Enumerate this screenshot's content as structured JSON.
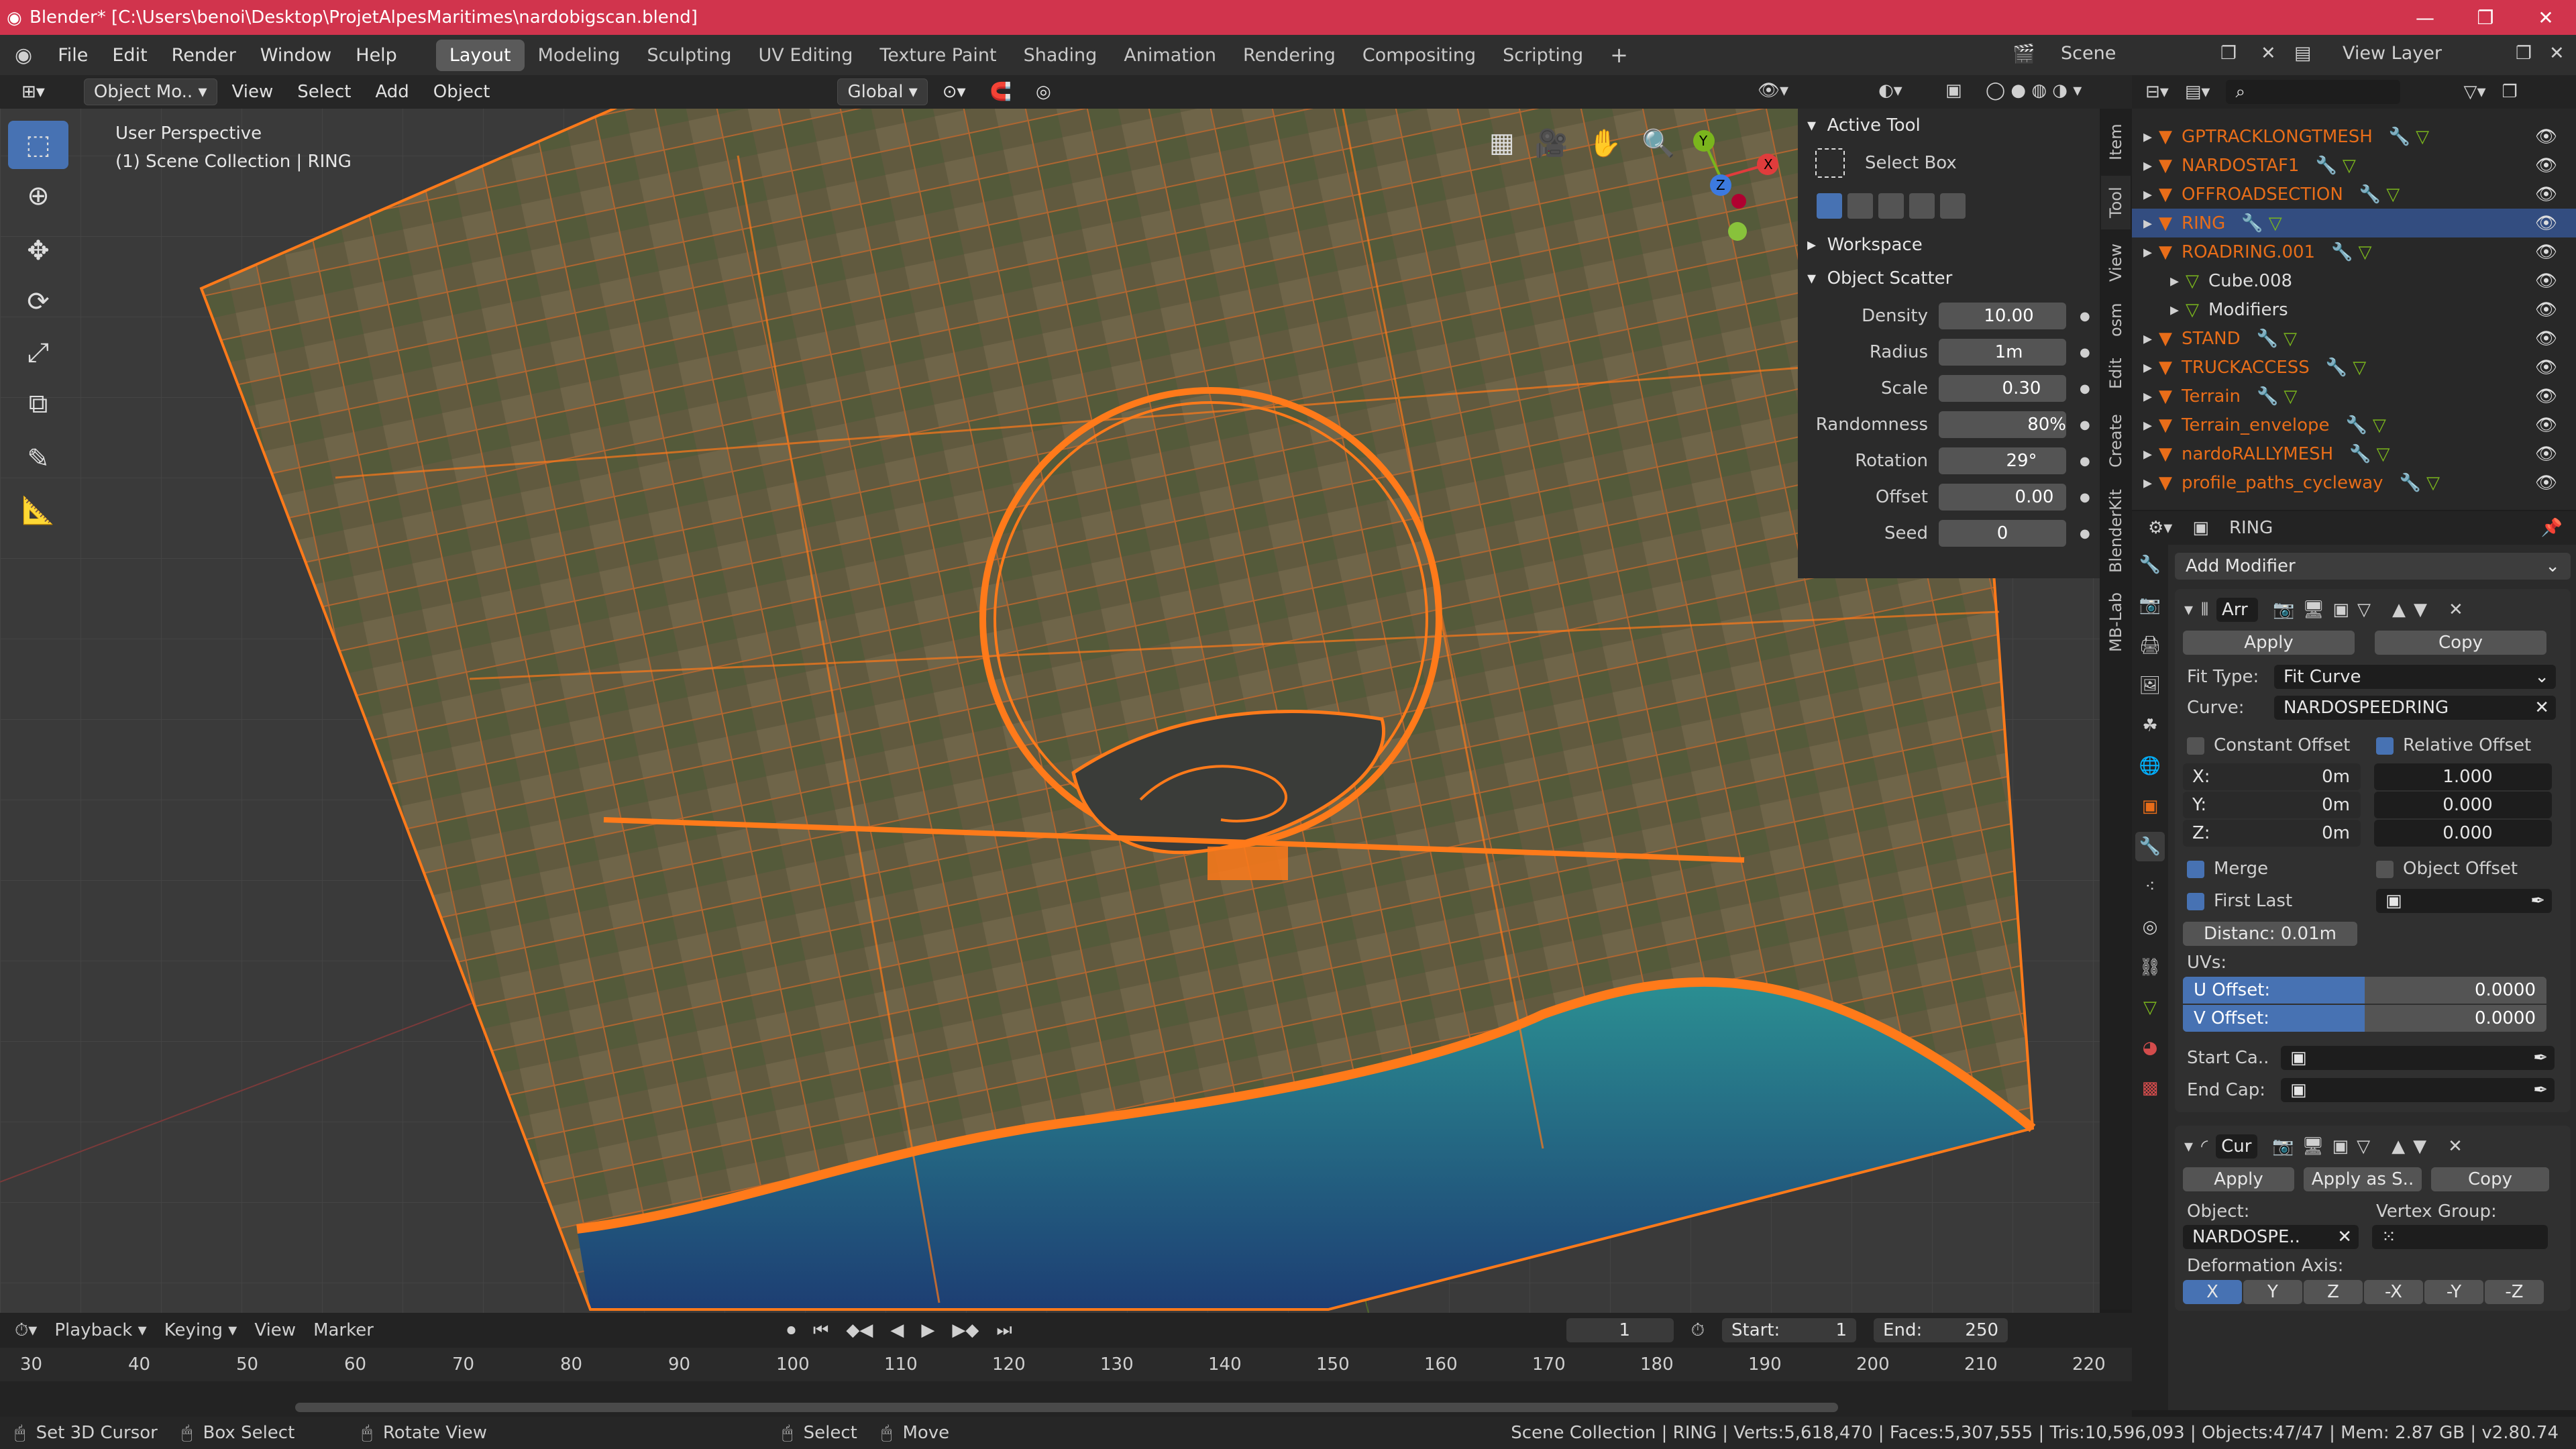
{
  "titlebar": {
    "title": "Blender* [C:\\Users\\benoi\\Desktop\\ProjetAlpesMaritimes\\nardobigscan.blend]"
  },
  "menus": [
    "File",
    "Edit",
    "Render",
    "Window",
    "Help"
  ],
  "workspaces": [
    "Layout",
    "Modeling",
    "Sculpting",
    "UV Editing",
    "Texture Paint",
    "Shading",
    "Animation",
    "Rendering",
    "Compositing",
    "Scripting"
  ],
  "scene": "Scene",
  "view_layer": "View Layer",
  "vpheader": {
    "mode": "Object Mo..",
    "view": "View",
    "select": "Select",
    "add": "Add",
    "object": "Object",
    "orientation": "Global"
  },
  "viewport": {
    "perspective": "User Perspective",
    "collection": "(1) Scene Collection | RING"
  },
  "npanel": {
    "active_tool": "Active Tool",
    "tool_name": "Select Box",
    "workspace": "Workspace",
    "scatter_title": "Object Scatter",
    "params": [
      {
        "label": "Density",
        "value": "10.00",
        "fill": 0.1
      },
      {
        "label": "Radius",
        "value": "1m",
        "fill": 0.1
      },
      {
        "label": "Scale",
        "value": "0.30",
        "fill": 0.3
      },
      {
        "label": "Randomness",
        "value": "80%",
        "fill": 0.8
      },
      {
        "label": "Rotation",
        "value": "29°",
        "fill": 0.3
      },
      {
        "label": "Offset",
        "value": "0.00",
        "fill": 0.5
      },
      {
        "label": "Seed",
        "value": "0",
        "fill": 0
      }
    ],
    "tabs": [
      "Item",
      "Tool",
      "View",
      "osm",
      "Edit",
      "Create",
      "BlenderKit",
      "MB-Lab"
    ]
  },
  "outliner": [
    {
      "name": "GPTRACKLONGTMESH",
      "sel": false
    },
    {
      "name": "NARDOSTAF1",
      "sel": false
    },
    {
      "name": "OFFROADSECTION",
      "sel": false
    },
    {
      "name": "RING",
      "sel": true
    },
    {
      "name": "ROADRING.001",
      "sel": false
    },
    {
      "name": "Cube.008",
      "sub": true
    },
    {
      "name": "Modifiers",
      "sub": true
    },
    {
      "name": "STAND",
      "sel": false
    },
    {
      "name": "TRUCKACCESS",
      "sel": false
    },
    {
      "name": "Terrain",
      "sel": false
    },
    {
      "name": "Terrain_envelope",
      "sel": false
    },
    {
      "name": "nardoRALLYMESH",
      "sel": false
    },
    {
      "name": "profile_paths_cycleway",
      "sel": false
    }
  ],
  "props": {
    "object": "RING",
    "add_modifier": "Add Modifier",
    "array": {
      "name": "Arr",
      "apply": "Apply",
      "copy": "Copy",
      "fit_type_label": "Fit Type:",
      "fit_type": "Fit Curve",
      "curve_label": "Curve:",
      "curve": "NARDOSPEEDRING",
      "constant_offset": "Constant Offset",
      "relative_offset": "Relative Offset",
      "const_x": "X:",
      "const_y": "Y:",
      "const_z": "Z:",
      "const_val": "0m",
      "rel_x": "1.000",
      "rel_y": "0.000",
      "rel_z": "0.000",
      "merge": "Merge",
      "object_offset": "Object Offset",
      "first_last": "First Last",
      "distance": "Distanc: 0.01m",
      "uvs": "UVs:",
      "u_offset": "U Offset:",
      "u_val": "0.0000",
      "v_offset": "V Offset:",
      "v_val": "0.0000",
      "start_cap": "Start Ca..",
      "end_cap": "End Cap:"
    },
    "curvemod": {
      "name": "Cur",
      "apply": "Apply",
      "apply_as": "Apply as S..",
      "copy": "Copy",
      "object_label": "Object:",
      "vg_label": "Vertex Group:",
      "object": "NARDOSPE..",
      "axis_label": "Deformation Axis:",
      "axes": [
        "X",
        "Y",
        "Z",
        "-X",
        "-Y",
        "-Z"
      ]
    }
  },
  "timeline": {
    "playback": "Playback",
    "keying": "Keying",
    "view": "View",
    "marker": "Marker",
    "frame": "1",
    "start": "Start:",
    "start_val": "1",
    "end": "End:",
    "end_val": "250",
    "ticks": [
      "30",
      "40",
      "50",
      "60",
      "70",
      "80",
      "90",
      "100",
      "110",
      "120",
      "130",
      "140",
      "150",
      "160",
      "170",
      "180",
      "190",
      "200",
      "210",
      "220"
    ]
  },
  "status": {
    "cursor": "Set 3D Cursor",
    "box": "Box Select",
    "rotate": "Rotate View",
    "select": "Select",
    "move": "Move",
    "stats": "Scene Collection | RING | Verts:5,618,470 | Faces:5,307,555 | Tris:10,596,093 | Objects:47/47 | Mem: 2.87 GB | v2.80.74"
  },
  "colors": {
    "accent": "#4772b3",
    "orange": "#e86d19",
    "title": "#d1344d"
  }
}
